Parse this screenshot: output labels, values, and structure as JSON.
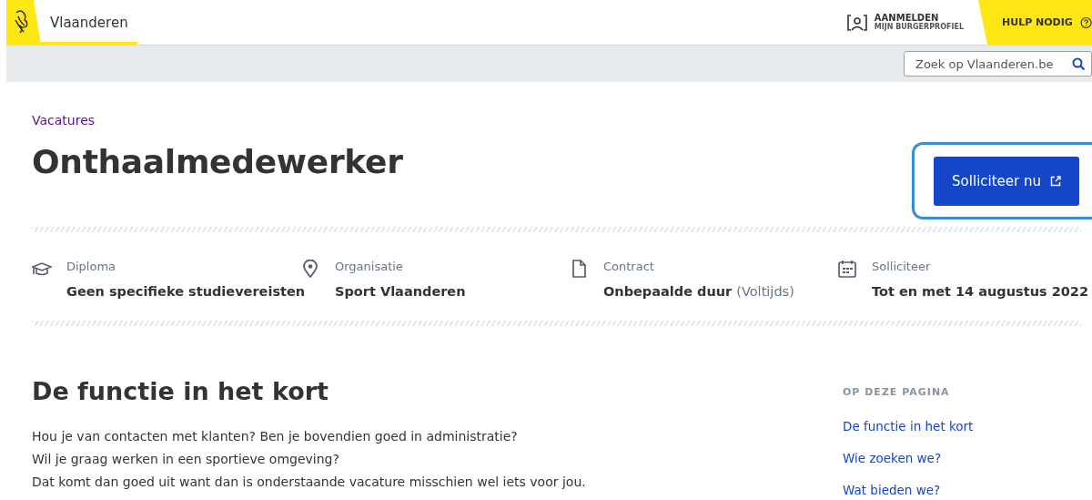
{
  "header": {
    "brand": "Vlaanderen",
    "login": {
      "title": "AANMELDEN",
      "subtitle": "MIJN BURGERPROFIEL"
    },
    "help": "HULP NODIG",
    "search": {
      "placeholder": "Zoek op Vlaanderen.be"
    }
  },
  "breadcrumb": "Vacatures",
  "title": "Onthaalmedewerker",
  "apply_button": {
    "label": "Solliciteer nu",
    "highlighted": true
  },
  "facts": [
    {
      "kind": "diploma",
      "label": "Diploma",
      "value": "Geen specifieke studievereisten"
    },
    {
      "kind": "location",
      "label": "Organisatie",
      "value": "Sport Vlaanderen"
    },
    {
      "kind": "document",
      "label": "Contract",
      "value": "Onbepaalde duur",
      "note": "(Voltijds)"
    },
    {
      "kind": "calendar",
      "label": "Solliciteer",
      "value": "Tot en met 14 augustus 2022"
    }
  ],
  "section": {
    "heading": "De functie in het kort",
    "lines": [
      "Hou je van contacten met klanten? Ben je bovendien goed in administratie?",
      "Wil je graag werken in een sportieve omgeving?",
      "Dat komt dan goed uit want dan is onderstaande vacature misschien wel iets voor jou."
    ]
  },
  "toc": {
    "title": "OP DEZE PAGINA",
    "links": [
      "De functie in het kort",
      "Wie zoeken we?",
      "Wat bieden we?"
    ]
  }
}
